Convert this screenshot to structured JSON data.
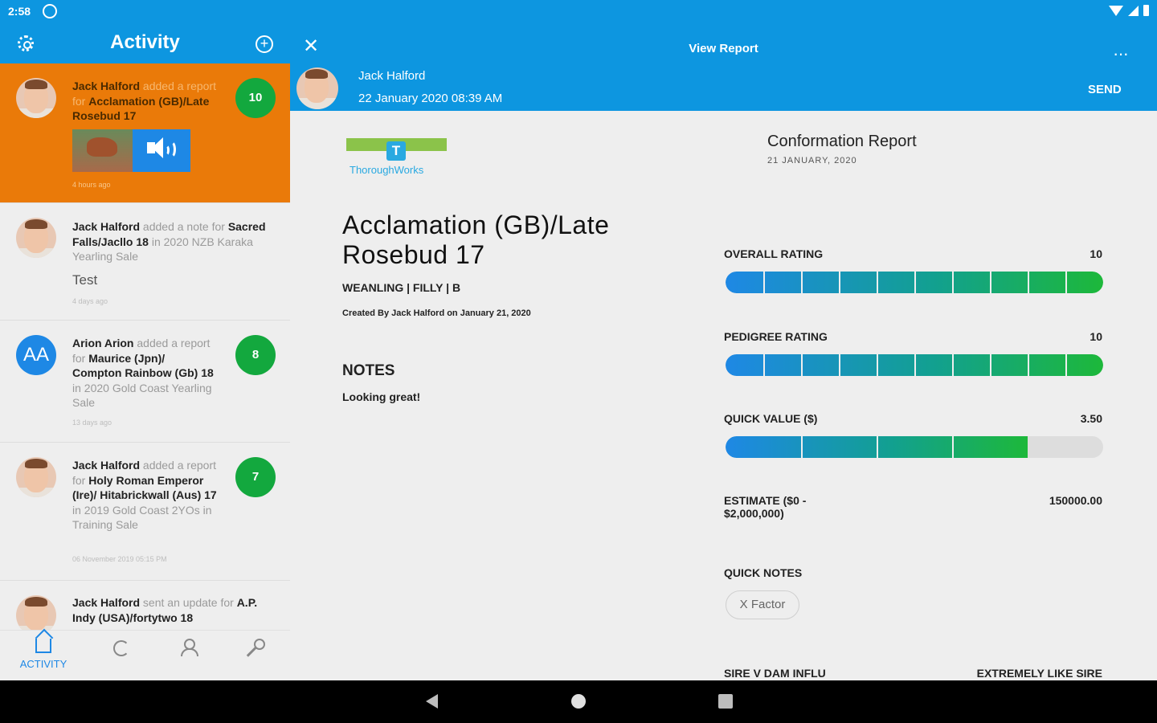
{
  "status_bar": {
    "time": "2:58"
  },
  "left_header": {
    "title": "Activity"
  },
  "activity": [
    {
      "name": "Jack Halford",
      "action": " added a report for ",
      "subject": "Acclamation (GB)/Late Rosebud 17",
      "rest": "",
      "score": "10",
      "time": "4 hours ago",
      "active": true
    },
    {
      "name": "Jack Halford",
      "action": " added a note for ",
      "subject": "Sacred Falls/Jacllo 18",
      "rest": " in 2020 NZB Karaka Yearling Sale",
      "note": "Test",
      "time": "4 days ago"
    },
    {
      "name": "Arion Arion",
      "initials": "AA",
      "action": " added a report for ",
      "subject": "Maurice (Jpn)/ Compton Rainbow (Gb) 18",
      "rest": " in 2020 Gold Coast Yearling Sale",
      "score": "8",
      "time": "13 days ago"
    },
    {
      "name": "Jack Halford",
      "action": " added a report for ",
      "subject": "Holy Roman Emperor (Ire)/ Hitabrickwall (Aus) 17",
      "rest": " in 2019 Gold Coast 2YOs in Training Sale",
      "score": "7",
      "time": "06 November 2019 05:15 PM"
    },
    {
      "name": "Jack Halford",
      "action": " sent an update for ",
      "subject": "A.P. Indy (USA)/fortytwo 18",
      "rest": ""
    }
  ],
  "bottom_nav": {
    "activity": "ACTIVITY"
  },
  "report_header": {
    "title": "View Report",
    "author": "Jack Halford",
    "date": "22 January 2020 08:39 AM",
    "send": "SEND"
  },
  "report": {
    "logo_text": "ThoroughWorks",
    "logo_letter": "T",
    "title": "Conformation Report",
    "date": "21 JANUARY, 2020",
    "horse_name": "Acclamation (GB)/Late Rosebud 17",
    "meta": "WEANLING | FILLY | B",
    "created": "Created By Jack Halford on January 21, 2020",
    "notes_heading": "NOTES",
    "notes": "Looking great!",
    "overall_label": "OVERALL RATING",
    "overall_value": "10",
    "overall_fraction": 1.0,
    "pedigree_label": "PEDIGREE RATING",
    "pedigree_value": "10",
    "pedigree_fraction": 1.0,
    "quick_value_label": "QUICK VALUE ($)",
    "quick_value_value": "3.50",
    "quick_value_fraction": 0.8,
    "estimate_label": "ESTIMATE ($0 - $2,000,000)",
    "estimate_value": "150000.00",
    "quick_notes_label": "QUICK NOTES",
    "quick_note_chip": "X Factor",
    "sire_label": "SIRE V DAM INFLU",
    "sire_value": "EXTREMELY LIKE SIRE"
  },
  "colors": {
    "primary": "#0d96e0",
    "accent_orange": "#ea7a09",
    "score_green": "#13a83e",
    "bar_blue": "#1e88e5",
    "bar_teal": "#12a090",
    "bar_green": "#1db83a"
  }
}
